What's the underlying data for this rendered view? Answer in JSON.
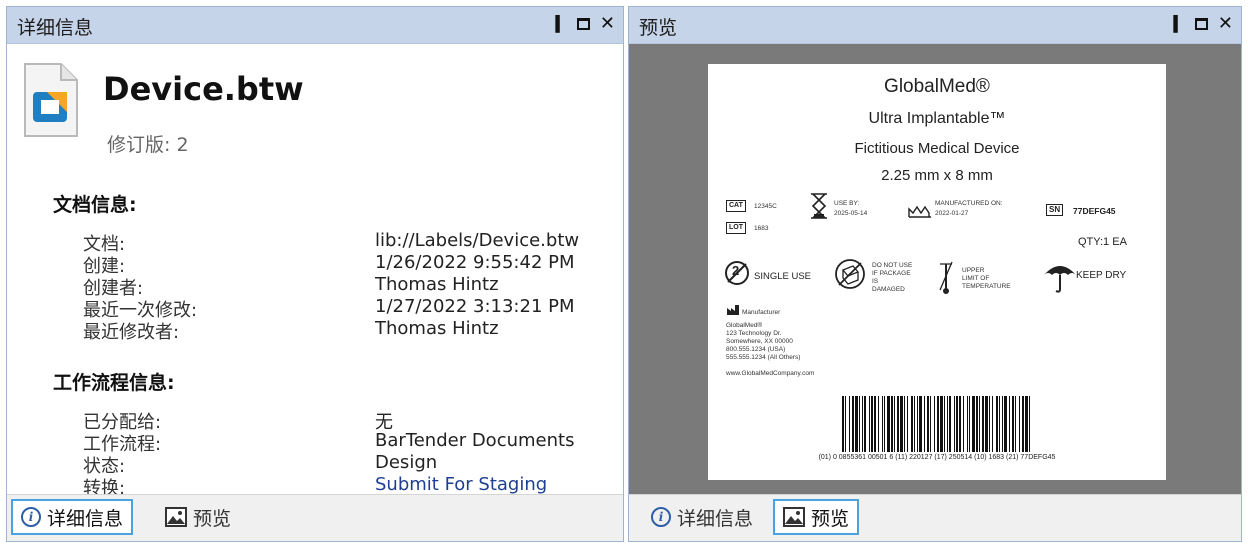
{
  "left_panel": {
    "title": "详细信息",
    "file": {
      "name": "Device.btw",
      "revision_label": "修订版: 2"
    },
    "doc_info": {
      "title": "文档信息:",
      "rows": [
        {
          "key": "文档:",
          "value": "lib://Labels/Device.btw"
        },
        {
          "key": "创建:",
          "value": "1/26/2022 9:55:42 PM"
        },
        {
          "key": "创建者:",
          "value": "Thomas Hintz"
        },
        {
          "key": "最近一次修改:",
          "value": "1/27/2022 3:13:21 PM"
        },
        {
          "key": "最近修改者:",
          "value": "Thomas Hintz"
        }
      ]
    },
    "workflow_info": {
      "title": "工作流程信息:",
      "rows": [
        {
          "key": "已分配给:",
          "value": "无"
        },
        {
          "key": "工作流程:",
          "value": "BarTender Documents"
        },
        {
          "key": "状态:",
          "value": "Design"
        },
        {
          "key": "转换:",
          "value": "Submit For Staging"
        }
      ]
    },
    "tabs": [
      {
        "label": "详细信息",
        "active": true
      },
      {
        "label": "预览",
        "active": false
      }
    ]
  },
  "right_panel": {
    "title": "预览",
    "label": {
      "brand": "GlobalMed®",
      "product": "Ultra Implantable™",
      "subtitle": "Fictitious Medical Device",
      "size": "2.25 mm x 8 mm",
      "cat_tag": "CAT",
      "cat_value": "12345C",
      "lot_tag": "LOT",
      "lot_value": "1683",
      "use_by_label": "USE BY:",
      "use_by_value": "2025-05-14",
      "manufactured_label": "MANUFACTURED ON:",
      "manufactured_value": "2022-01-27",
      "sn_tag": "SN",
      "sn_value": "77DEFG45",
      "qty": "QTY:1 EA",
      "single_use": "SINGLE USE",
      "single_use_num": "2",
      "damaged_line1": "DO NOT USE",
      "damaged_line2": "IF PACKAGE",
      "damaged_line3": "IS",
      "damaged_line4": "DAMAGED",
      "temp_line1": "UPPER",
      "temp_line2": "LIMIT OF",
      "temp_line3": "TEMPERATURE",
      "keep_dry": "KEEP DRY",
      "manufacturer_label": "Manufacturer",
      "address": [
        "GlobalMed®",
        "123 Technology Dr.",
        "Somewhere, XX 00000",
        "800.555.1234 (USA)",
        "555.555.1234 (All Others)",
        "www.GlobalMedCompany.com"
      ],
      "barcode_text": "(01) 0 0855361 00501 6 (11) 220127 (17) 250514 (10) 1683 (21) 77DEFG45"
    },
    "tabs": [
      {
        "label": "详细信息",
        "active": false
      },
      {
        "label": "预览",
        "active": true
      }
    ]
  },
  "colors": {
    "titlebar": "#c6d4e9",
    "accent_tab_border": "#4aa3df",
    "link": "#1e3f91",
    "preview_background": "#7a7a7a"
  },
  "icons": [
    "pin-icon",
    "maximize-icon",
    "close-icon",
    "info-icon",
    "preview-icon",
    "file-icon",
    "barcode"
  ]
}
